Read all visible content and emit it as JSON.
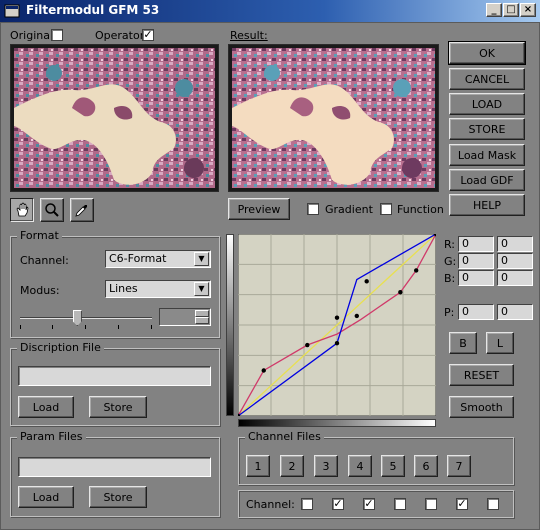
{
  "window": {
    "title": "Filtermodul GFM 53",
    "icon": "app-window-icon",
    "controls": [
      "_",
      "□",
      "×"
    ]
  },
  "top": {
    "original_label": "Original:",
    "operator_label": "Operator:",
    "result_label": "Result:",
    "original_checked": false,
    "operator_checked": true,
    "operator_mark": "✓"
  },
  "tools": [
    "hand-tool-icon",
    "magnifier-icon",
    "eyedropper-icon"
  ],
  "preview_row": {
    "preview_label": "Preview",
    "gradient_label": "Gradient",
    "function_label": "Function"
  },
  "right_buttons": [
    "OK",
    "CANCEL",
    "LOAD",
    "STORE",
    "Load Mask",
    "Load GDF",
    "HELP"
  ],
  "format": {
    "title": "Format",
    "channel_label": "Channel:",
    "channel_value": "C6-Format",
    "modus_label": "Modus:",
    "modus_value": "Lines",
    "slider_level": 0.43
  },
  "description_file": {
    "title": "Discription File",
    "value": "",
    "load_label": "Load",
    "store_label": "Store"
  },
  "param_files": {
    "title": "Param Files",
    "value": "",
    "load_label": "Load",
    "store_label": "Store"
  },
  "rgb": {
    "r_label": "R:",
    "g_label": "G:",
    "b_label": "B:",
    "p_label": "P:",
    "r": [
      "0",
      "0"
    ],
    "g": [
      "0",
      "0"
    ],
    "b": [
      "0",
      "0"
    ],
    "p": [
      "0",
      "0"
    ]
  },
  "curve_buttons": {
    "b_label": "B",
    "l_label": "L",
    "reset_label": "RESET",
    "smooth_label": "Smooth"
  },
  "channel_files": {
    "title": "Channel Files",
    "buttons": [
      "1",
      "2",
      "3",
      "4",
      "5",
      "6",
      "7"
    ]
  },
  "channel_row": {
    "label": "Channel:",
    "checked": [
      false,
      true,
      true,
      false,
      false,
      true,
      false
    ],
    "mark": "✓"
  },
  "chart_data": {
    "type": "line",
    "xlim": [
      0,
      1
    ],
    "ylim": [
      0,
      1
    ],
    "grid": true,
    "series": [
      {
        "color": "#0000e0",
        "x": [
          0,
          0.5,
          0.6,
          1
        ],
        "y": [
          0,
          0.4,
          0.75,
          1
        ]
      },
      {
        "color": "#d03a6a",
        "x": [
          0,
          0.13,
          0.35,
          0.5,
          0.62,
          0.82,
          0.9,
          1
        ],
        "y": [
          0,
          0.25,
          0.39,
          0.45,
          0.53,
          0.68,
          0.8,
          1
        ]
      },
      {
        "color": "#e8e050",
        "x": [
          0,
          1
        ],
        "y": [
          0,
          1
        ]
      }
    ],
    "points": [
      {
        "x": 0.13,
        "y": 0.25
      },
      {
        "x": 0.35,
        "y": 0.39
      },
      {
        "x": 0.5,
        "y": 0.54
      },
      {
        "x": 0.5,
        "y": 0.4
      },
      {
        "x": 0.6,
        "y": 0.55
      },
      {
        "x": 0.65,
        "y": 0.74
      },
      {
        "x": 0.82,
        "y": 0.68
      },
      {
        "x": 0.9,
        "y": 0.8
      },
      {
        "x": 1,
        "y": 1
      },
      {
        "x": 0,
        "y": 0
      }
    ]
  }
}
